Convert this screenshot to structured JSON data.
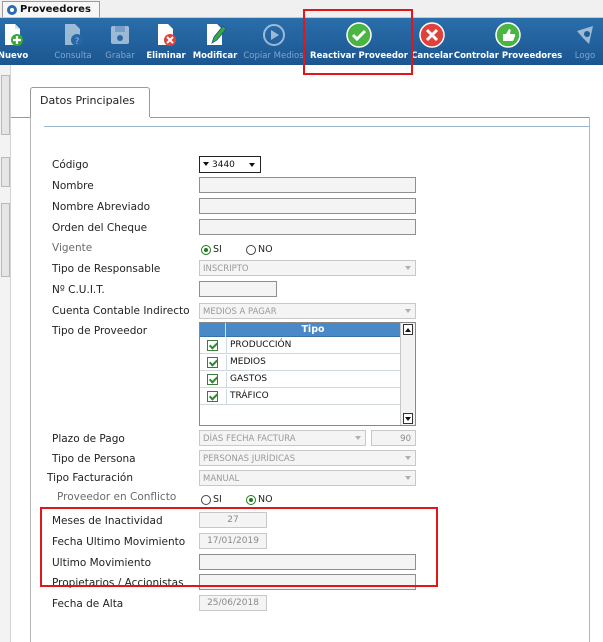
{
  "window": {
    "tab_title": "Proveedores"
  },
  "toolbar": {
    "buttons": [
      {
        "label": "Nuevo",
        "icon": "new-document-icon",
        "enabled": true
      },
      {
        "label": "Consulta",
        "icon": "query-document-icon",
        "enabled": false
      },
      {
        "label": "Grabar",
        "icon": "save-disk-icon",
        "enabled": false
      },
      {
        "label": "Eliminar",
        "icon": "delete-document-icon",
        "enabled": true
      },
      {
        "label": "Modificar",
        "icon": "edit-pencil-icon",
        "enabled": true
      },
      {
        "label": "Copiar Medios",
        "icon": "play-circle-icon",
        "enabled": false
      },
      {
        "label": "Reactivar Proveedor",
        "icon": "green-check-icon",
        "enabled": true
      },
      {
        "label": "Cancelar",
        "icon": "red-x-circle-icon",
        "enabled": true
      },
      {
        "label": "Controlar Proveedores",
        "icon": "thumbs-up-icon",
        "enabled": true
      },
      {
        "label": "Logo",
        "icon": "logo-icon",
        "enabled": false
      }
    ]
  },
  "main_tab": {
    "label": "Datos Principales"
  },
  "form": {
    "codigo": {
      "label": "Código",
      "value": "3440"
    },
    "nombre": {
      "label": "Nombre",
      "value": ""
    },
    "nombre_abreviado": {
      "label": "Nombre Abreviado",
      "value": ""
    },
    "orden_cheque": {
      "label": "Orden del Cheque",
      "value": ""
    },
    "vigente": {
      "label": "Vigente",
      "options": [
        "SI",
        "NO"
      ],
      "selected": "SI"
    },
    "tipo_responsable": {
      "label": "Tipo de Responsable",
      "value": "INSCRIPTO"
    },
    "cuit": {
      "label": "Nº C.U.I.T.",
      "value": ""
    },
    "cuenta_contable": {
      "label": "Cuenta Contable Indirecto",
      "value": "MEDIOS A PAGAR"
    },
    "tipo_proveedor": {
      "label": "Tipo de Proveedor",
      "column": "Tipo",
      "rows": [
        "PRODUCCIÓN",
        "MEDIOS",
        "GASTOS",
        "TRÁFICO"
      ]
    },
    "plazo_pago": {
      "label": "Plazo de Pago",
      "value": "DÍAS FECHA FACTURA",
      "days": "90"
    },
    "tipo_persona": {
      "label": "Tipo de Persona",
      "value": "PERSONAS JURÍDICAS"
    },
    "tipo_facturacion": {
      "label": "Tipo Facturación",
      "value": "MANUAL"
    },
    "proveedor_conflicto": {
      "label": "Proveedor en Conflicto",
      "options": [
        "SI",
        "NO"
      ],
      "selected": "NO"
    },
    "meses_inactividad": {
      "label": "Meses de Inactividad",
      "value": "27"
    },
    "fecha_ultimo_mov": {
      "label": "Fecha Ultimo Movimiento",
      "value": "17/01/2019"
    },
    "ultimo_mov": {
      "label": "Ultimo Movimiento",
      "value": ""
    },
    "propietarios": {
      "label": "Propietarios / Accionistas",
      "value": ""
    },
    "fecha_alta": {
      "label": "Fecha de Alta",
      "value": "25/06/2018"
    }
  },
  "colors": {
    "toolbar_bg": "#1f5f9a",
    "highlight": "#e0161b",
    "grid_header": "#4a89c8",
    "check_green": "#2f8a2f"
  }
}
